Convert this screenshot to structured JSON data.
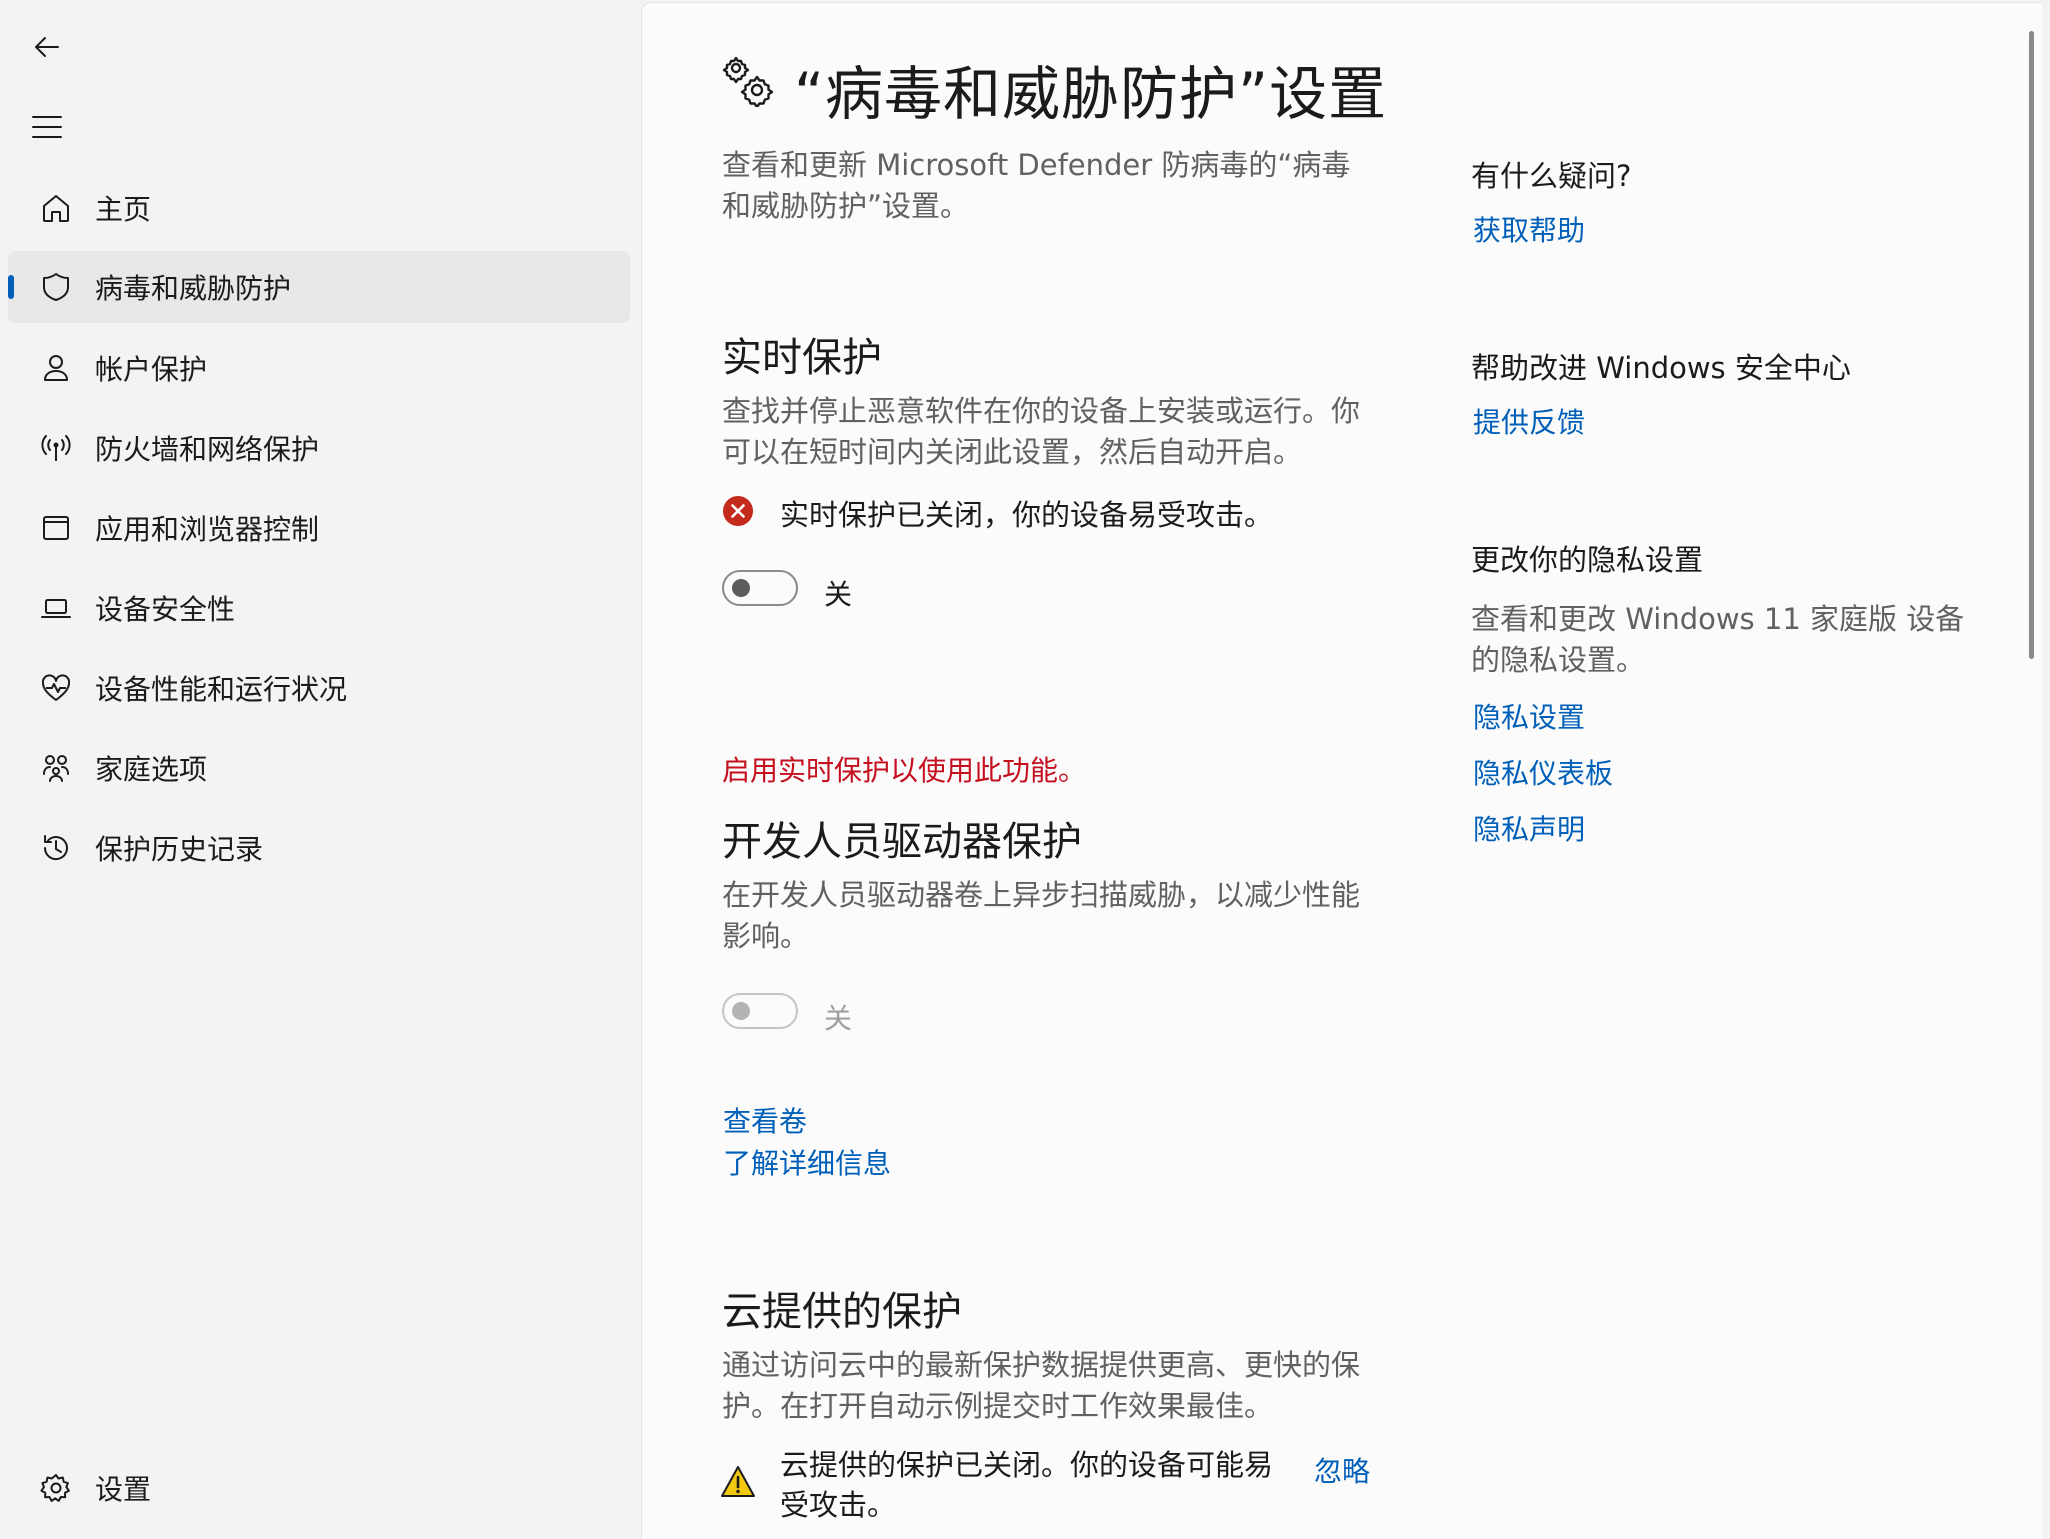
{
  "sidebar": {
    "items": [
      {
        "label": "主页",
        "icon": "home-icon"
      },
      {
        "label": "病毒和威胁防护",
        "icon": "shield-icon",
        "active": true
      },
      {
        "label": "帐户保护",
        "icon": "person-icon"
      },
      {
        "label": "防火墙和网络保护",
        "icon": "antenna-icon"
      },
      {
        "label": "应用和浏览器控制",
        "icon": "app-window-icon"
      },
      {
        "label": "设备安全性",
        "icon": "laptop-icon"
      },
      {
        "label": "设备性能和运行状况",
        "icon": "heart-pulse-icon"
      },
      {
        "label": "家庭选项",
        "icon": "family-icon"
      },
      {
        "label": "保护历史记录",
        "icon": "history-icon"
      }
    ],
    "settings_label": "设置"
  },
  "main": {
    "title": "“病毒和威胁防护”设置",
    "intro": "查看和更新 Microsoft Defender 防病毒的“病毒和威胁防护”设置。",
    "realtime": {
      "title": "实时保护",
      "desc": "查找并停止恶意软件在你的设备上安装或运行。你可以在短时间内关闭此设置，然后自动开启。",
      "alert": "实时保护已关闭，你的设备易受攻击。",
      "toggle_label": "关",
      "toggle_on": false
    },
    "devdrive": {
      "notice": "启用实时保护以使用此功能。",
      "title": "开发人员驱动器保护",
      "desc": "在开发人员驱动器卷上异步扫描威胁，以减少性能影响。",
      "toggle_label": "关",
      "toggle_on": false,
      "links": [
        "查看卷",
        "了解详细信息"
      ]
    },
    "cloud": {
      "title": "云提供的保护",
      "desc": "通过访问云中的最新保护数据提供更高、更快的保护。在打开自动示例提交时工作效果最佳。",
      "alert_line1": "云提供的保护已关闭。你的设备可能易",
      "alert_line2": "受攻击。",
      "dismiss": "忽略"
    }
  },
  "aside": {
    "question_heading": "有什么疑问?",
    "get_help": "获取帮助",
    "improve_heading": "帮助改进 Windows 安全中心",
    "feedback": "提供反馈",
    "privacy_heading": "更改你的隐私设置",
    "privacy_desc": "查看和更改 Windows 11 家庭版 设备的隐私设置。",
    "privacy_links": [
      "隐私设置",
      "隐私仪表板",
      "隐私声明"
    ]
  },
  "colors": {
    "accent": "#005fb8",
    "error": "#c42b1c",
    "warning": "#f2c811",
    "notice_text": "#c50f1f"
  }
}
